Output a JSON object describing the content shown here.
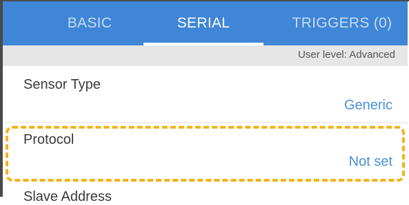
{
  "tabs": [
    {
      "label": "BASIC",
      "active": false
    },
    {
      "label": "SERIAL",
      "active": true
    },
    {
      "label": "TRIGGERS (0)",
      "active": false
    }
  ],
  "user_level": "User level: Advanced",
  "settings": {
    "sensor_type": {
      "label": "Sensor Type",
      "value": "Generic"
    },
    "protocol": {
      "label": "Protocol",
      "value": "Not set"
    },
    "slave_address": {
      "label": "Slave Address"
    }
  },
  "colors": {
    "tab_bar": "#3f86d6",
    "value_text": "#4a8fd8",
    "highlight": "#f2b31b"
  }
}
